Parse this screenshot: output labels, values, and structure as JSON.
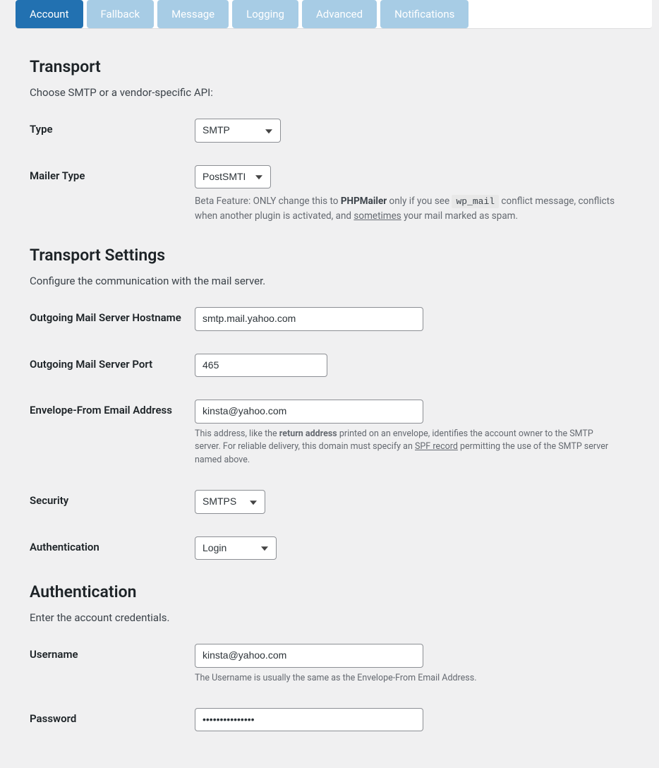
{
  "tabs": [
    {
      "label": "Account",
      "active": true
    },
    {
      "label": "Fallback",
      "active": false
    },
    {
      "label": "Message",
      "active": false
    },
    {
      "label": "Logging",
      "active": false
    },
    {
      "label": "Advanced",
      "active": false
    },
    {
      "label": "Notifications",
      "active": false
    }
  ],
  "transport": {
    "heading": "Transport",
    "intro": "Choose SMTP or a vendor-specific API:",
    "type_label": "Type",
    "type_value": "SMTP",
    "mailer_label": "Mailer Type",
    "mailer_value": "PostSMTP",
    "mailer_help_pre": "Beta Feature: ONLY change this to ",
    "mailer_help_bold": "PHPMailer",
    "mailer_help_mid1": " only if you see ",
    "mailer_help_code": "wp_mail",
    "mailer_help_mid2": " conflict message, conflicts when another plugin is activated, and ",
    "mailer_help_u": "sometimes",
    "mailer_help_post": " your mail marked as spam."
  },
  "settings": {
    "heading": "Transport Settings",
    "intro": "Configure the communication with the mail server.",
    "host_label": "Outgoing Mail Server Hostname",
    "host_value": "smtp.mail.yahoo.com",
    "port_label": "Outgoing Mail Server Port",
    "port_value": "465",
    "envelope_label": "Envelope-From Email Address",
    "envelope_value": "kinsta@yahoo.com",
    "envelope_help_pre": "This address, like the ",
    "envelope_help_bold": "return address",
    "envelope_help_mid": " printed on an envelope, identifies the account owner to the SMTP server. For reliable delivery, this domain must specify an ",
    "envelope_help_u": "SPF record",
    "envelope_help_post": " permitting the use of the SMTP server named above.",
    "security_label": "Security",
    "security_value": "SMTPS",
    "auth_label": "Authentication",
    "auth_value": "Login"
  },
  "auth": {
    "heading": "Authentication",
    "intro": "Enter the account credentials.",
    "username_label": "Username",
    "username_value": "kinsta@yahoo.com",
    "username_help": "The Username is usually the same as the Envelope-From Email Address.",
    "password_label": "Password",
    "password_value": "•••••••••••••••"
  }
}
